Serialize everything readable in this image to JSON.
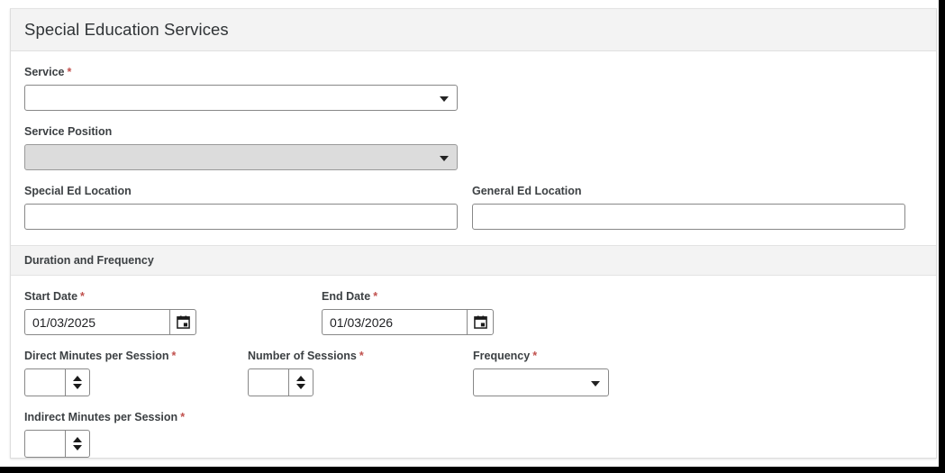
{
  "window": {
    "title": "Special Education Services"
  },
  "form": {
    "service": {
      "label": "Service",
      "required": "*",
      "value": "",
      "caret_icon": "chevron-down-icon"
    },
    "service_position": {
      "label": "Service Position",
      "value": "",
      "disabled": true,
      "caret_icon": "chevron-down-icon"
    },
    "special_ed_location": {
      "label": "Special Ed Location",
      "value": ""
    },
    "general_ed_location": {
      "label": "General Ed Location",
      "value": ""
    }
  },
  "duration_section": {
    "title": "Duration and Frequency",
    "start_date": {
      "label": "Start Date",
      "required": "*",
      "value": "01/03/2025",
      "picker_icon": "calendar-icon"
    },
    "end_date": {
      "label": "End Date",
      "required": "*",
      "value": "01/03/2026",
      "picker_icon": "calendar-icon"
    },
    "direct_minutes": {
      "label": "Direct Minutes per Session",
      "required": "*",
      "value": "",
      "up_icon": "spinner-up-icon",
      "down_icon": "spinner-down-icon"
    },
    "number_of_sessions": {
      "label": "Number of Sessions",
      "required": "*",
      "value": "",
      "up_icon": "spinner-up-icon",
      "down_icon": "spinner-down-icon"
    },
    "frequency": {
      "label": "Frequency",
      "required": "*",
      "value": "",
      "caret_icon": "chevron-down-icon"
    },
    "indirect_minutes": {
      "label": "Indirect Minutes per Session",
      "required": "*",
      "value": "",
      "up_icon": "spinner-up-icon",
      "down_icon": "spinner-down-icon"
    }
  },
  "colors": {
    "required_asterisk": "#c0504d",
    "header_bg": "#f3f3f3",
    "border": "#888888",
    "disabled_bg": "#dcdcdc",
    "text": "#3c4043"
  }
}
